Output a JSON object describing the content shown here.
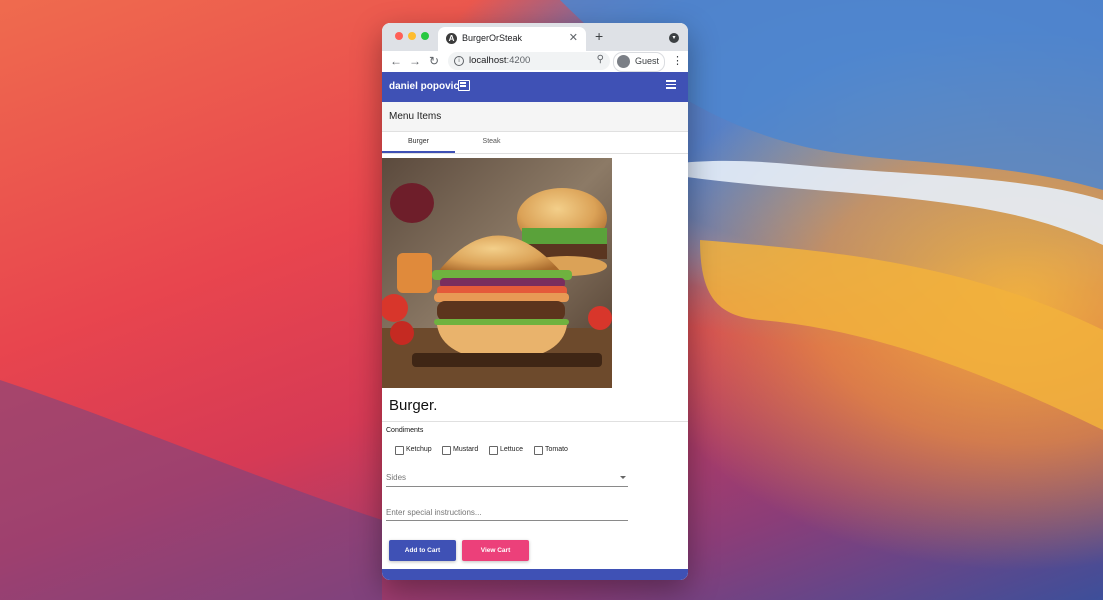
{
  "browser": {
    "tab_title": "BurgerOrSteak",
    "tab_favicon": "angular-icon",
    "close_glyph": "✕",
    "new_tab_glyph": "+",
    "url_host": "localhost",
    "url_port": ":4200",
    "profile_label": "Guest",
    "icons": [
      "back-arrow-icon",
      "forward-arrow-icon",
      "reload-icon",
      "info-icon",
      "zoom-icon",
      "profile-avatar-icon",
      "more-vert-icon",
      "tab-search-icon"
    ]
  },
  "app": {
    "brand": "daniel popovic_",
    "brand_icon": "menu-book-icon",
    "menu_icon": "hamburger-menu-icon",
    "section_title": "Menu Items",
    "tabs": [
      {
        "label": "Burger",
        "active": true
      },
      {
        "label": "Steak",
        "active": false
      }
    ],
    "item_title": "Burger.",
    "item_image": "burger-photo",
    "condiments_label": "Condiments",
    "condiments": [
      {
        "label": "Ketchup",
        "checked": false
      },
      {
        "label": "Mustard",
        "checked": false
      },
      {
        "label": "Lettuce",
        "checked": false
      },
      {
        "label": "Tomato",
        "checked": false
      }
    ],
    "sides_placeholder": "Sides",
    "instructions_placeholder": "Enter special instructions...",
    "add_to_cart_label": "Add to Cart",
    "view_cart_label": "View Cart",
    "colors": {
      "primary": "#3f51b5",
      "accent": "#ec407a"
    }
  }
}
